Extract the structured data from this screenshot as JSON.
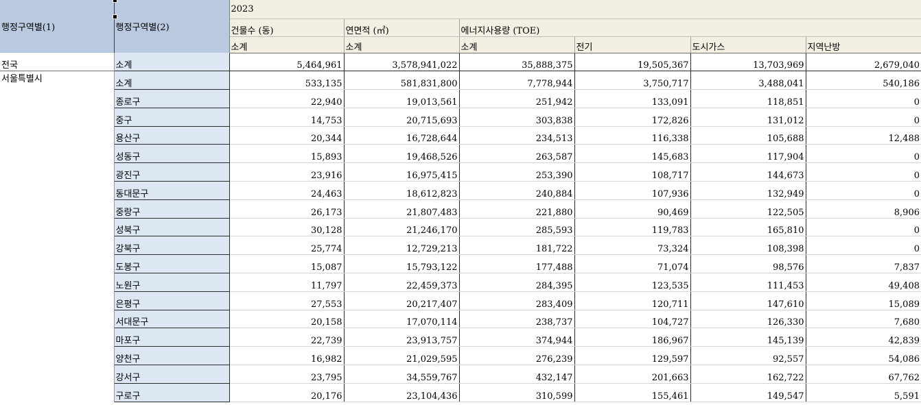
{
  "header": {
    "stub_label_1": "행정구역별(1)",
    "stub_label_2": "행정구역별(2)",
    "year": "2023",
    "groups": [
      "건물수 (동)",
      "연면적 (㎡)",
      "에너지사용량 (TOE)"
    ],
    "subheaders": [
      "소계",
      "소계",
      "소계",
      "전기",
      "도시가스",
      "지역난방"
    ]
  },
  "rows": [
    {
      "region": "전국",
      "district": "소계",
      "values": [
        "5,464,961",
        "3,578,941,022",
        "35,888,375",
        "19,505,367",
        "13,703,969",
        "2,679,040"
      ]
    },
    {
      "region": "서울특별시",
      "district": "소계",
      "values": [
        "533,135",
        "581,831,800",
        "7,778,944",
        "3,750,717",
        "3,488,041",
        "540,186"
      ]
    },
    {
      "region": "",
      "district": "종로구",
      "values": [
        "22,940",
        "19,013,561",
        "251,942",
        "133,091",
        "118,851",
        "0"
      ]
    },
    {
      "region": "",
      "district": "중구",
      "values": [
        "14,753",
        "20,715,693",
        "303,838",
        "172,826",
        "131,012",
        "0"
      ]
    },
    {
      "region": "",
      "district": "용산구",
      "values": [
        "20,344",
        "16,728,644",
        "234,513",
        "116,338",
        "105,688",
        "12,488"
      ]
    },
    {
      "region": "",
      "district": "성동구",
      "values": [
        "15,893",
        "19,468,526",
        "263,587",
        "145,683",
        "117,904",
        "0"
      ]
    },
    {
      "region": "",
      "district": "광진구",
      "values": [
        "23,916",
        "16,975,415",
        "253,390",
        "108,717",
        "144,673",
        "0"
      ]
    },
    {
      "region": "",
      "district": "동대문구",
      "values": [
        "24,463",
        "18,612,823",
        "240,884",
        "107,936",
        "132,949",
        "0"
      ]
    },
    {
      "region": "",
      "district": "중랑구",
      "values": [
        "26,173",
        "21,807,483",
        "221,880",
        "90,469",
        "122,505",
        "8,906"
      ]
    },
    {
      "region": "",
      "district": "성북구",
      "values": [
        "30,128",
        "21,246,170",
        "285,593",
        "119,783",
        "165,810",
        "0"
      ]
    },
    {
      "region": "",
      "district": "강북구",
      "values": [
        "25,774",
        "12,729,213",
        "181,722",
        "73,324",
        "108,398",
        "0"
      ]
    },
    {
      "region": "",
      "district": "도봉구",
      "values": [
        "15,087",
        "15,793,122",
        "177,488",
        "71,074",
        "98,576",
        "7,837"
      ]
    },
    {
      "region": "",
      "district": "노원구",
      "values": [
        "11,797",
        "22,459,373",
        "284,395",
        "123,535",
        "111,453",
        "49,408"
      ]
    },
    {
      "region": "",
      "district": "은평구",
      "values": [
        "27,553",
        "20,217,407",
        "283,409",
        "120,711",
        "147,610",
        "15,089"
      ]
    },
    {
      "region": "",
      "district": "서대문구",
      "values": [
        "20,158",
        "17,070,114",
        "238,737",
        "104,727",
        "126,330",
        "7,680"
      ]
    },
    {
      "region": "",
      "district": "마포구",
      "values": [
        "22,739",
        "23,913,757",
        "374,944",
        "186,967",
        "145,139",
        "42,839"
      ]
    },
    {
      "region": "",
      "district": "양천구",
      "values": [
        "16,982",
        "21,029,595",
        "276,239",
        "129,597",
        "92,557",
        "54,086"
      ]
    },
    {
      "region": "",
      "district": "강서구",
      "values": [
        "23,795",
        "34,559,767",
        "432,147",
        "201,663",
        "162,722",
        "67,762"
      ]
    },
    {
      "region": "",
      "district": "구로구",
      "values": [
        "20,176",
        "23,104,436",
        "310,599",
        "155,461",
        "149,547",
        "5,591"
      ]
    }
  ]
}
